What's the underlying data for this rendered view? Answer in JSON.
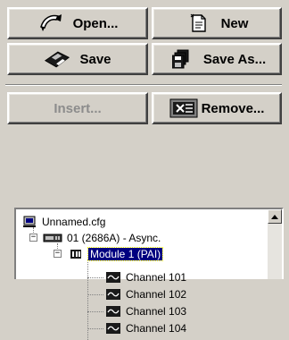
{
  "toolbar": {
    "open_label": "Open...",
    "new_label": "New",
    "save_label": "Save",
    "save_as_label": "Save As...",
    "insert_label": "Insert...",
    "remove_label": "Remove..."
  },
  "tree": {
    "root": "Unnamed.cfg",
    "device": "01 (2686A) - Async.",
    "module": "Module 1 (PAI)",
    "channels": [
      "Channel 101",
      "Channel 102",
      "Channel 103",
      "Channel 104"
    ]
  },
  "icons": {
    "open": "open-icon",
    "new": "new-document-icon",
    "save": "save-disk-icon",
    "save_as": "save-as-icon",
    "insert": "insert-icon",
    "remove": "remove-module-icon"
  }
}
